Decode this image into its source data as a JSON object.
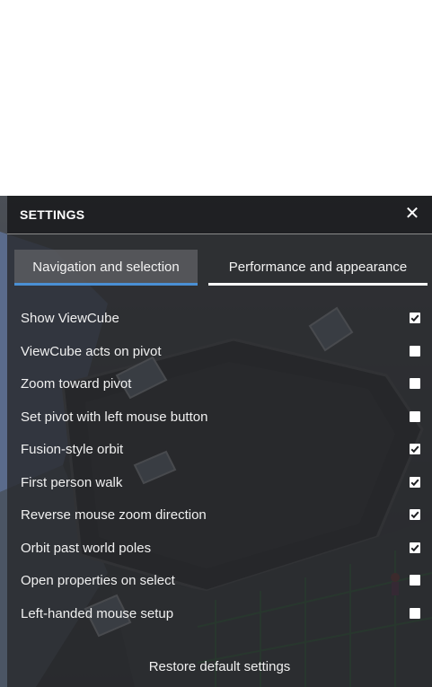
{
  "panel": {
    "title": "SETTINGS",
    "close_glyph": "✕"
  },
  "tabs": [
    {
      "label": "Navigation and selection",
      "active": true
    },
    {
      "label": "Performance and appearance",
      "active": false
    }
  ],
  "options": [
    {
      "label": "Show ViewCube",
      "checked": true
    },
    {
      "label": "ViewCube acts on pivot",
      "checked": false
    },
    {
      "label": "Zoom toward pivot",
      "checked": false
    },
    {
      "label": "Set pivot with left mouse button",
      "checked": false
    },
    {
      "label": "Fusion-style orbit",
      "checked": true
    },
    {
      "label": "First person walk",
      "checked": true
    },
    {
      "label": "Reverse mouse zoom direction",
      "checked": true
    },
    {
      "label": "Orbit past world poles",
      "checked": true
    },
    {
      "label": "Open properties on select",
      "checked": false
    },
    {
      "label": "Left-handed mouse setup",
      "checked": false
    }
  ],
  "footer": {
    "restore_label": "Restore default settings"
  },
  "colors": {
    "active_tab_underline": "#4a8fd4",
    "inactive_tab_underline": "#ffffff",
    "panel_bg": "#28292c"
  }
}
